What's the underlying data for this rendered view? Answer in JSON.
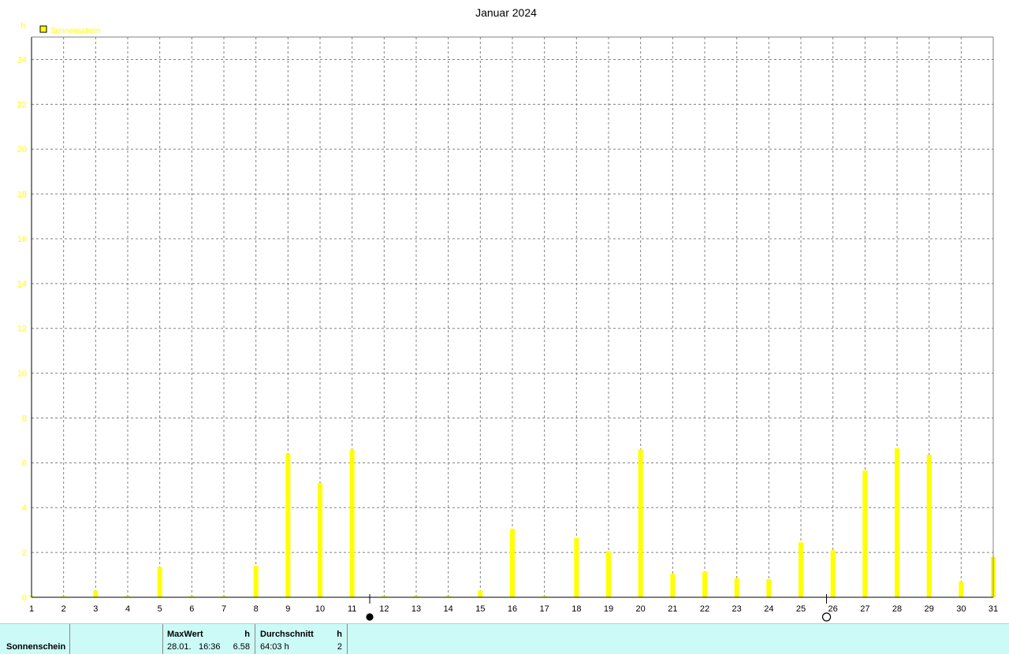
{
  "chart_data": {
    "type": "bar",
    "title": "Januar 2024",
    "ylabel": "h",
    "ylim": [
      0,
      25
    ],
    "yticks": [
      "0",
      "2",
      "4",
      "6",
      "8",
      "10",
      "12",
      "14",
      "16",
      "18",
      "20",
      "22",
      "24"
    ],
    "x_tick_labels": [
      "1",
      "2",
      "3",
      "4",
      "5",
      "6",
      "7",
      "8",
      "9",
      "10",
      "11",
      "12",
      "13",
      "14",
      "15",
      "16",
      "17",
      "18",
      "19",
      "20",
      "21",
      "22",
      "23",
      "24",
      "25",
      "26",
      "27",
      "28",
      "29",
      "30",
      "31"
    ],
    "grid": true,
    "legend_position": "top-left",
    "series": [
      {
        "name": "Sonnenschein",
        "color": "#ffff00",
        "x": [
          1,
          2,
          3,
          4,
          5,
          6,
          7,
          8,
          9,
          10,
          11,
          12,
          13,
          14,
          15,
          16,
          17,
          18,
          19,
          20,
          21,
          22,
          23,
          24,
          25,
          26,
          27,
          28,
          29,
          30,
          31
        ],
        "values": [
          0.05,
          0.05,
          0.3,
          0.05,
          1.35,
          0.05,
          0.05,
          1.4,
          6.4,
          5.1,
          6.6,
          0.05,
          0.05,
          0.05,
          0.3,
          3.05,
          0.05,
          2.65,
          2.05,
          6.6,
          1.05,
          1.15,
          0.85,
          0.8,
          2.45,
          2.1,
          5.65,
          6.65,
          6.35,
          0.7,
          1.8
        ]
      }
    ],
    "moon_phases": [
      {
        "day": 11.55,
        "phase": "new-moon"
      },
      {
        "day": 25.8,
        "phase": "full-moon"
      }
    ]
  },
  "footer": {
    "series_label": "Sonnenschein",
    "max_header": "MaxWert",
    "max_unit": "h",
    "max_date": "28.01.",
    "max_time": "16:36",
    "max_value": "6.58",
    "avg_header": "Durchschnitt",
    "avg_unit": "h",
    "avg_total": "64:03 h",
    "avg_value": "2"
  }
}
